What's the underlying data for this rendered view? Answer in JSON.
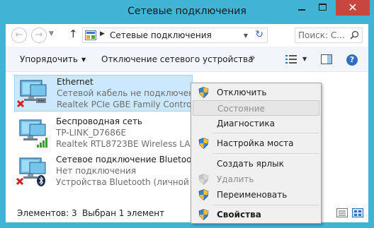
{
  "window": {
    "title": "Сетевые подключения",
    "close_symbol": "✕"
  },
  "address": {
    "location": "Сетевые подключения",
    "search_placeholder": "Поиск: С..."
  },
  "commandbar": {
    "organize": "Упорядочить",
    "disconnect": "Отключение сетевого устройства",
    "more": "»",
    "help": "?"
  },
  "connections": [
    {
      "name": "Ethernet",
      "status": "Сетевой кабель не подключен",
      "device": "Realtek PCIe GBE Family Controller",
      "selected": true,
      "icon": "ethernet-disconnected-icon"
    },
    {
      "name": "Беспроводная сеть",
      "status": "TP-LINK_D7686E",
      "device": "Realtek RTL8723BE Wireless LAN ...",
      "selected": false,
      "icon": "wireless-connected-icon"
    },
    {
      "name": "Сетевое подключение Bluetooth",
      "status": "Нет подключения",
      "device": "Устройства Bluetooth (личной с...",
      "selected": false,
      "icon": "bluetooth-disconnected-icon"
    }
  ],
  "statusbar": {
    "count": "Элементов: 3",
    "selection": "Выбран 1 элемент"
  },
  "context_menu": {
    "items": [
      {
        "label": "Отключить",
        "shield": true,
        "state": "normal"
      },
      {
        "label": "Состояние",
        "shield": false,
        "state": "disabled"
      },
      {
        "label": "Диагностика",
        "shield": false,
        "state": "normal"
      },
      {
        "label": "Настройка моста",
        "shield": true,
        "state": "normal"
      },
      {
        "label": "Создать ярлык",
        "shield": false,
        "state": "normal"
      },
      {
        "label": "Удалить",
        "shield": true,
        "state": "disabled"
      },
      {
        "label": "Переименовать",
        "shield": true,
        "state": "normal"
      },
      {
        "label": "Свойства",
        "shield": true,
        "state": "bold"
      }
    ]
  },
  "colors": {
    "window_frame": "#41b3d4",
    "selection_fill": "#cce8ff",
    "selection_border": "#99d1ff",
    "close_button": "#c7463f",
    "menu_background": "#f0f0f0"
  }
}
